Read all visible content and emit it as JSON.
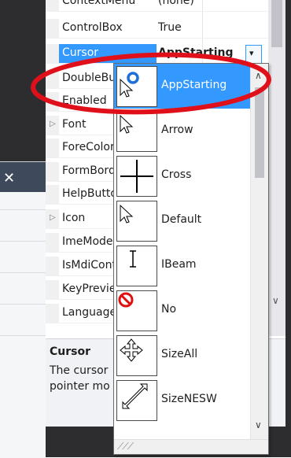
{
  "properties": [
    {
      "name": "ContextMenu",
      "value": "(none)",
      "expander": false
    },
    {
      "name": "ControlBox",
      "value": "True",
      "expander": false
    },
    {
      "name": "Cursor",
      "value": "AppStarting",
      "expander": false,
      "selected": true
    },
    {
      "name": "DoubleBuffered",
      "value": "",
      "expander": false
    },
    {
      "name": "Enabled",
      "value": "",
      "expander": false
    },
    {
      "name": "Font",
      "value": "",
      "expander": true
    },
    {
      "name": "ForeColor",
      "value": "",
      "expander": false
    },
    {
      "name": "FormBorderStyle",
      "value": "",
      "expander": false
    },
    {
      "name": "HelpButton",
      "value": "",
      "expander": false
    },
    {
      "name": "Icon",
      "value": "",
      "expander": true
    },
    {
      "name": "ImeMode",
      "value": "",
      "expander": false
    },
    {
      "name": "IsMdiContainer",
      "value": "",
      "expander": false
    },
    {
      "name": "KeyPreview",
      "value": "",
      "expander": false
    },
    {
      "name": "Language",
      "value": "",
      "expander": false
    }
  ],
  "description": {
    "title": "Cursor",
    "line1": "The cursor",
    "line2": "pointer mo"
  },
  "cursor_dropdown": {
    "selected": "AppStarting",
    "items": [
      {
        "label": "AppStarting",
        "icon": "app-starting-cursor-icon"
      },
      {
        "label": "Arrow",
        "icon": "arrow-cursor-icon"
      },
      {
        "label": "Cross",
        "icon": "cross-cursor-icon"
      },
      {
        "label": "Default",
        "icon": "default-cursor-icon"
      },
      {
        "label": "IBeam",
        "icon": "ibeam-cursor-icon"
      },
      {
        "label": "No",
        "icon": "no-cursor-icon"
      },
      {
        "label": "SizeAll",
        "icon": "size-all-cursor-icon"
      },
      {
        "label": "SizeNESW",
        "icon": "size-nesw-cursor-icon"
      }
    ]
  },
  "colors": {
    "selection": "#3399ff",
    "annotation": "#e0101a",
    "dark_chrome": "#2d2d30"
  }
}
